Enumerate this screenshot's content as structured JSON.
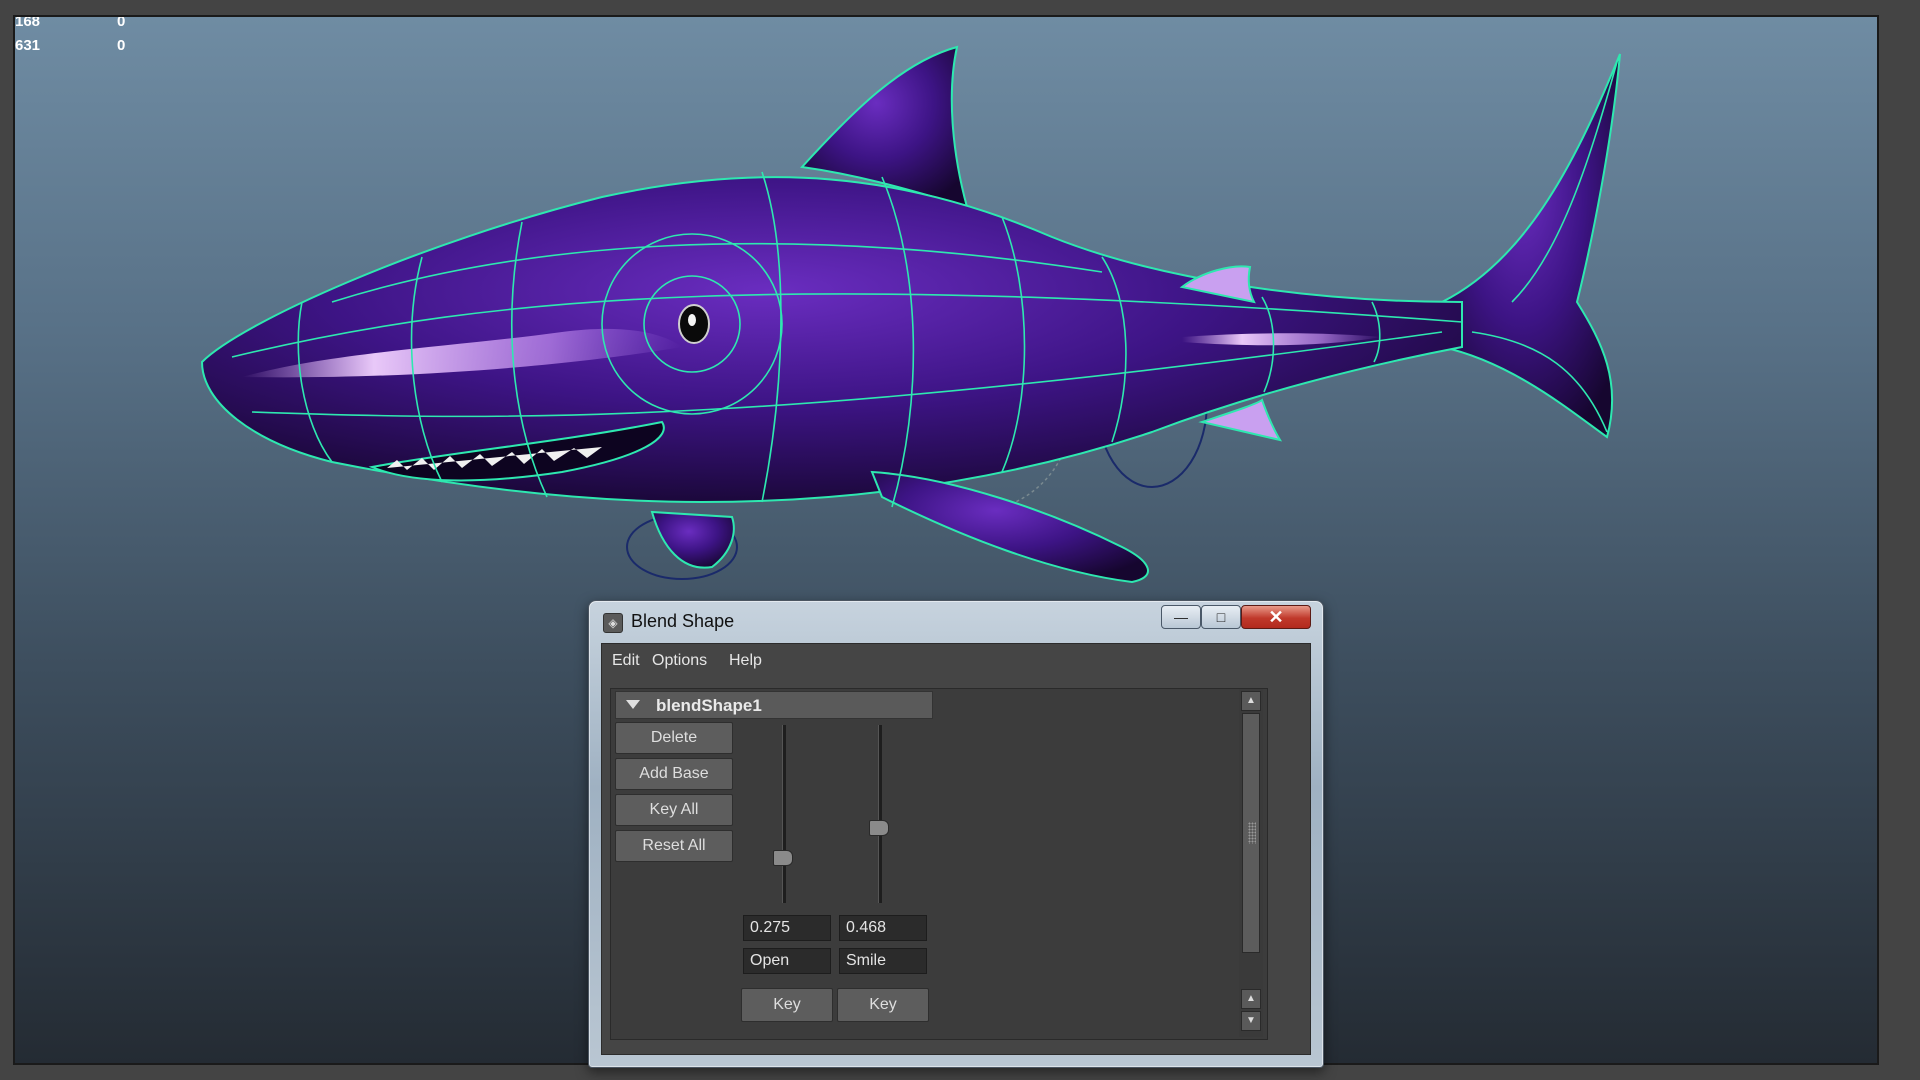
{
  "hud": {
    "row1_left": "168",
    "row1_right": "0",
    "row2_left": "631",
    "row2_right": "0"
  },
  "window": {
    "title": "Blend Shape",
    "controls": {
      "minimize": "—",
      "maximize": "□",
      "close": "✕"
    },
    "icon": "maya-app-icon"
  },
  "menu": [
    "Edit",
    "Options",
    "Help"
  ],
  "blend_node": {
    "name": "blendShape1",
    "buttons": [
      "Delete",
      "Add Base",
      "Key All",
      "Reset All"
    ],
    "targets": [
      {
        "name": "Open",
        "weight": "0.275",
        "key_label": "Key"
      },
      {
        "name": "Smile",
        "weight": "0.468",
        "key_label": "Key"
      }
    ]
  },
  "colors": {
    "shark_body": "#3a0f7a",
    "wireframe": "#2ee8b0",
    "viewport_top": "#6f8ca3",
    "viewport_bottom": "#242b33"
  }
}
